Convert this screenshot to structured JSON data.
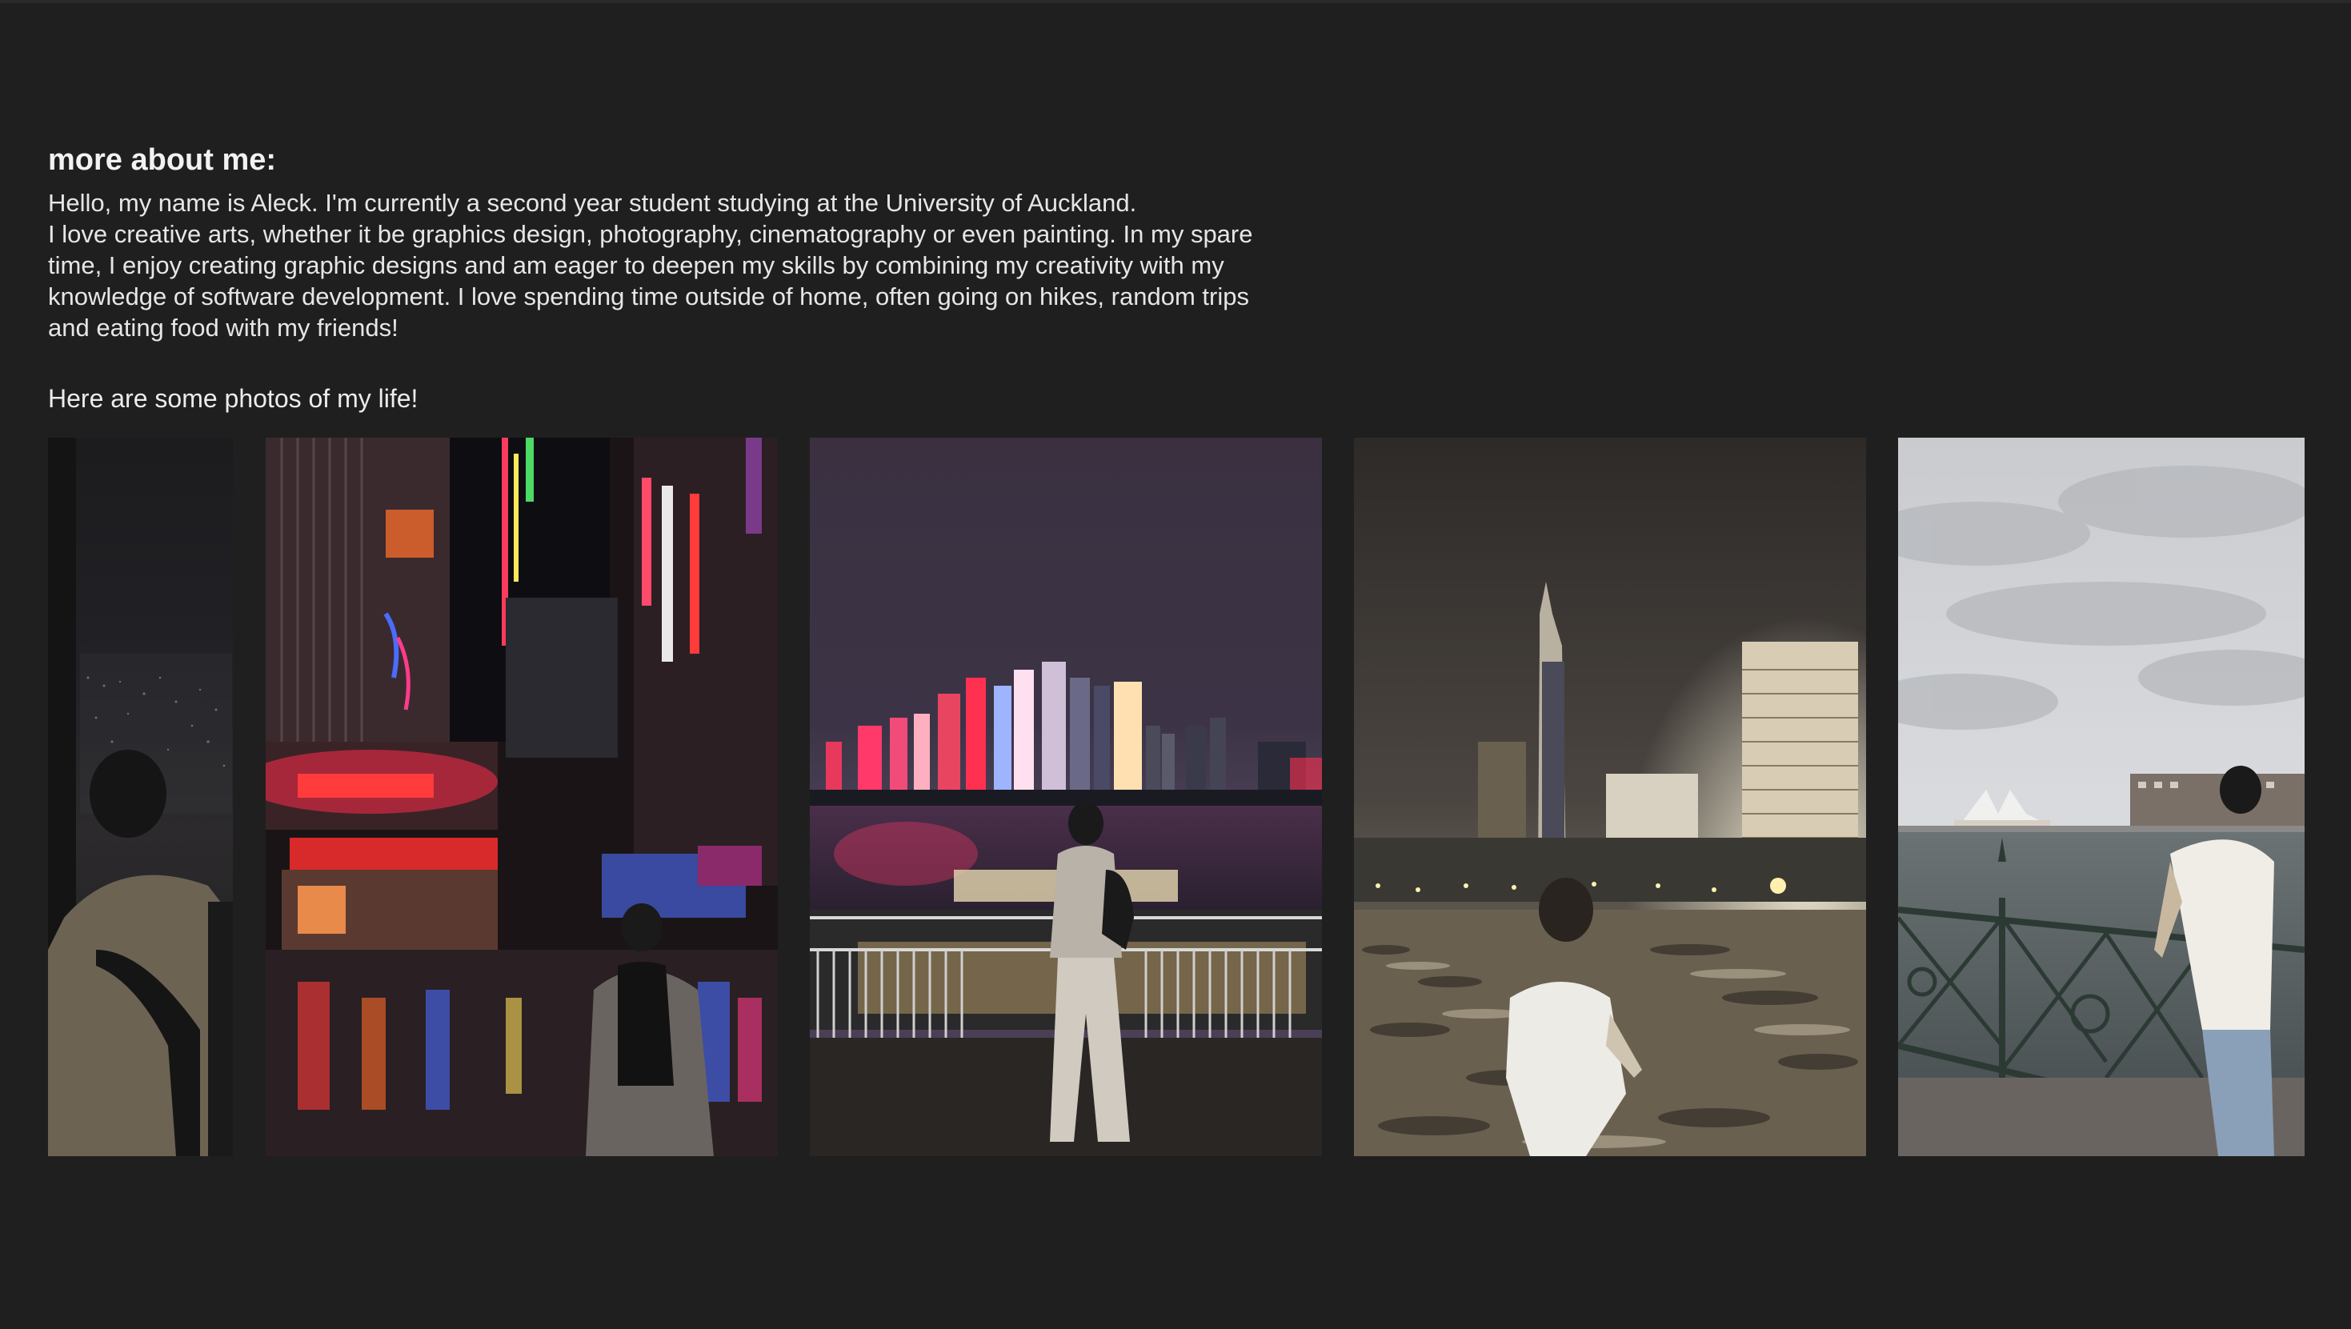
{
  "heading": "more about me:",
  "bio": {
    "line1": "Hello, my name is Aleck. I'm currently a second year student studying at the University of Auckland.",
    "line2": "I love creative arts, whether it be graphics design, photography, cinematography or even painting. In my spare time, I enjoy creating graphic designs and am eager to deepen my skills by combining my creativity with my knowledge of software development. I love spending time outside of home, often going on hikes, random trips and eating food with my friends!"
  },
  "photos_intro": "Here are some photos of my life!",
  "photos": [
    {
      "id": "city-night-window"
    },
    {
      "id": "neon-street-rain"
    },
    {
      "id": "river-skyline-night"
    },
    {
      "id": "beach-night-towers"
    },
    {
      "id": "harbour-opera-house"
    }
  ],
  "colors": {
    "background": "#1f1f1f",
    "text": "#e9e9e9"
  }
}
